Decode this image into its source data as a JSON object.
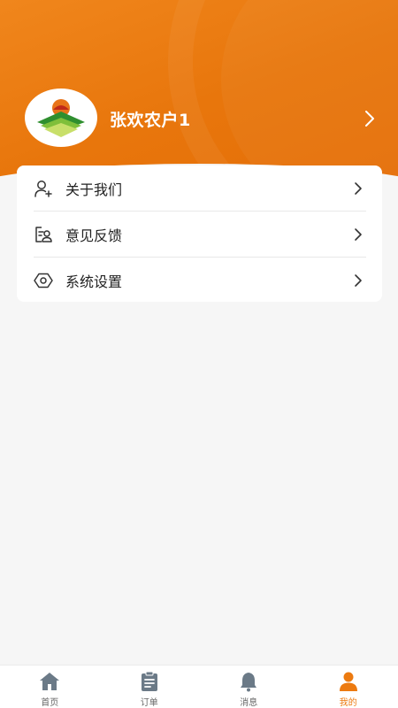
{
  "profile": {
    "name": "张欢农户1",
    "logo_icon": "farm-logo-icon"
  },
  "menu": {
    "items": [
      {
        "label": "关于我们",
        "icon": "user-add-icon"
      },
      {
        "label": "意见反馈",
        "icon": "feedback-icon"
      },
      {
        "label": "系统设置",
        "icon": "settings-icon"
      }
    ]
  },
  "tabbar": {
    "tabs": [
      {
        "label": "首页",
        "icon": "home-icon",
        "active": false
      },
      {
        "label": "订单",
        "icon": "clipboard-icon",
        "active": false
      },
      {
        "label": "消息",
        "icon": "bell-icon",
        "active": false
      },
      {
        "label": "我的",
        "icon": "person-icon",
        "active": true
      }
    ]
  },
  "colors": {
    "accent": "#ec7a10",
    "header": "#e8760c",
    "inactive_icon": "#6b7a87"
  }
}
